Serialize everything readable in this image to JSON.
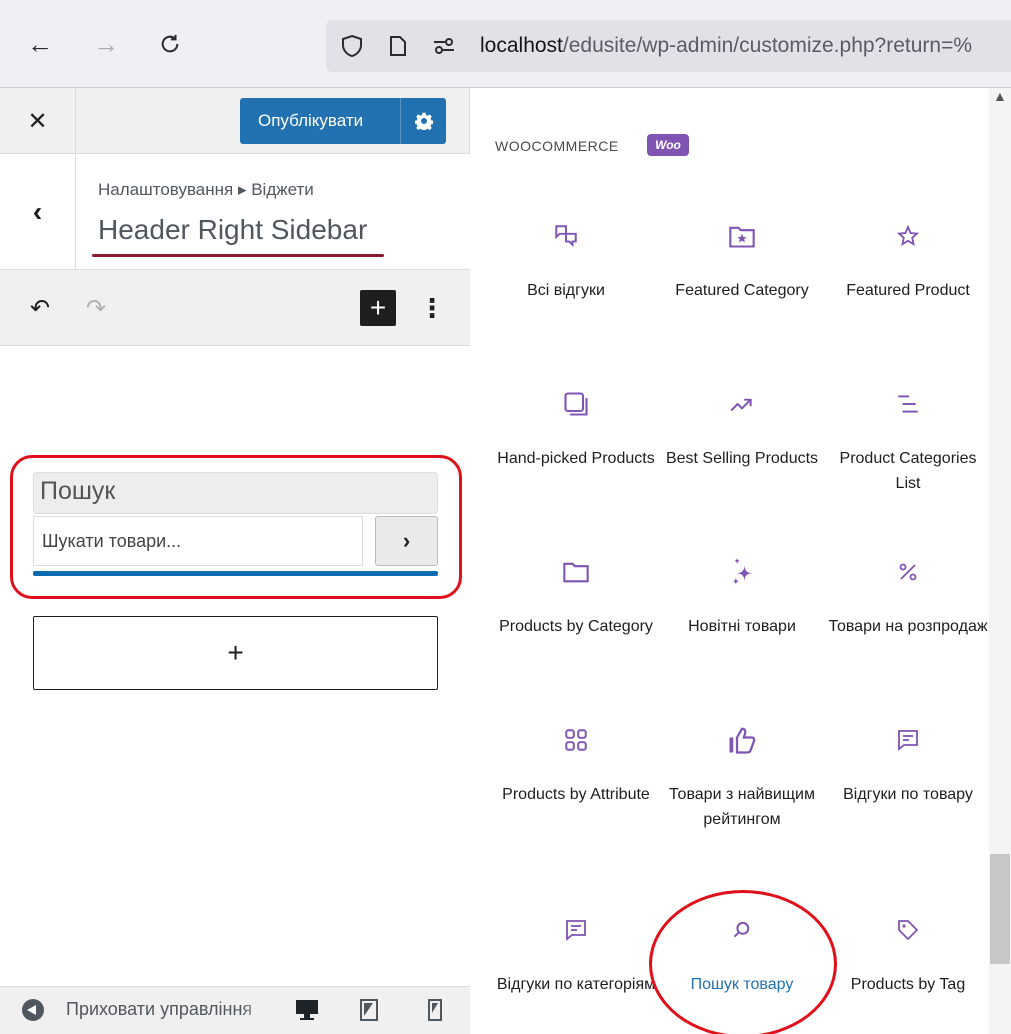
{
  "browser": {
    "url_host": "localhost",
    "url_path": "/edusite/wp-admin/customize.php?return=%"
  },
  "customizer": {
    "publish_label": "Опублікувати",
    "breadcrumb": "Налаштовування ▸ Віджети",
    "section_title": "Header Right Sidebar",
    "collapse_label": "Приховати управління"
  },
  "search_widget": {
    "title": "Пошук",
    "placeholder": "Шукати товари..."
  },
  "inserter": {
    "category_label": "WOOCOMMERCE",
    "badge": "Woo",
    "accent_color": "#7f54b3",
    "blocks": [
      {
        "label": "Всі відгуки",
        "icon": "comments-icon"
      },
      {
        "label": "Featured Category",
        "icon": "folder-star-icon"
      },
      {
        "label": "Featured Product",
        "icon": "star-icon"
      },
      {
        "label": "Hand-picked Products",
        "icon": "stacked-squares-icon"
      },
      {
        "label": "Best Selling Products",
        "icon": "trending-up-icon"
      },
      {
        "label": "Product Categories List",
        "icon": "list-icon"
      },
      {
        "label": "Products by Category",
        "icon": "folder-icon"
      },
      {
        "label": "Новітні товари",
        "icon": "sparkles-icon"
      },
      {
        "label": "Товари на розпродаж",
        "icon": "percent-icon"
      },
      {
        "label": "Products by Attribute",
        "icon": "grid-icon"
      },
      {
        "label": "Товари з найвищим рейтингом",
        "icon": "thumbs-up-icon"
      },
      {
        "label": "Відгуки по товару",
        "icon": "comment-icon"
      },
      {
        "label": "Відгуки по категоріям",
        "icon": "comment-icon"
      },
      {
        "label": "Пошук товару",
        "icon": "search-icon"
      },
      {
        "label": "Products by Tag",
        "icon": "tag-icon"
      }
    ]
  }
}
